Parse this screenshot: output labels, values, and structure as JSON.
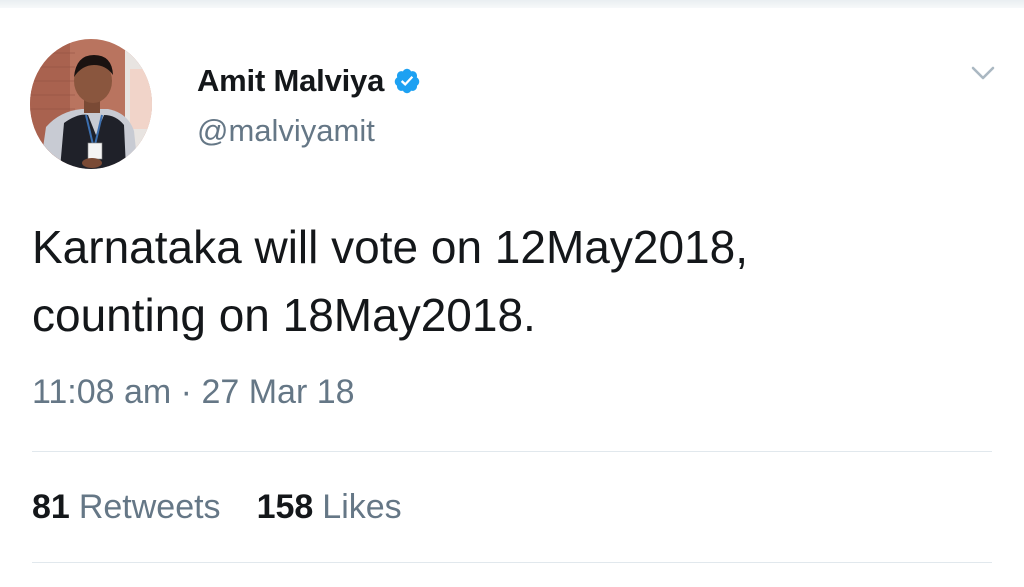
{
  "author": {
    "display_name": "Amit Malviya",
    "handle": "@malviyamit",
    "verified": true
  },
  "tweet": {
    "line1": "Karnataka will vote on 12May2018,",
    "line2": "counting on 18May2018.",
    "timestamp": "11:08 am · 27 Mar 18"
  },
  "stats": {
    "retweets_count": "81",
    "retweets_label": "Retweets",
    "likes_count": "158",
    "likes_label": "Likes"
  },
  "icons": {
    "verified": "verified-badge-icon",
    "menu": "chevron-down-icon"
  },
  "colors": {
    "text": "#14171a",
    "secondary": "#657786",
    "verified_blue": "#1da1f2",
    "divider": "#e1e8ed"
  }
}
